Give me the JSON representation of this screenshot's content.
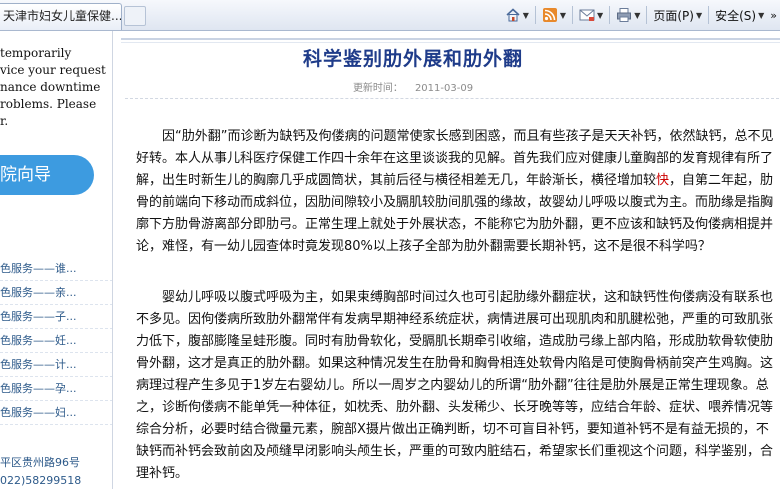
{
  "browser": {
    "tab_title": "天津市妇女儿童保健...",
    "toolbar": {
      "page_menu_label": "页面(P)",
      "safety_menu_label": "安全(S)"
    }
  },
  "sidebar": {
    "notice_lines": [
      "temporarily",
      "vice your request",
      "nance downtime",
      "roblems. Please",
      "r."
    ],
    "guide_label": "院向导",
    "services": [
      "色服务——谁...",
      "色服务——亲...",
      "色服务——子...",
      "色服务——妊...",
      "色服务——计...",
      "色服务——孕...",
      "色服务——妇..."
    ],
    "address": "平区贵州路96号",
    "phone": "022)58299518"
  },
  "article": {
    "title": "科学鉴别肋外展和肋外翻",
    "meta_label": "更新时间：",
    "meta_date": "2011-03-09",
    "p1_before": "因“肋外翻”而诊断为缺钙及佝偻病的问题常使家长感到困惑，而且有些孩子是天天补钙，依然缺钙，总不见好转。本人从事儿科医疗保健工作四十余年在这里谈谈我的见解。首先我们应对健康儿童胸部的发育规律有所了解，出生时新生儿的胸廓几乎成圆筒状，其前后径与横径相差无几，年龄渐长，横径增加较",
    "p1_highlight": "快",
    "p1_after": "，自第二年起，肋骨的前端向下移动而成斜位，因肋间隙较小及膈肌较肋间肌强的缘故，故婴幼儿呼吸以腹式为主。而肋缘是指胸廓下方肋骨游离部分即肋弓。正常生理上就处于外展状态，不能称它为肋外翻，更不应该和缺钙及佝偻病相提并论，难怪，有一幼儿园查体时竟发现80%以上孩子全部为肋外翻需要长期补钙，这不是很不科学吗？",
    "p2": "婴幼儿呼吸以腹式呼吸为主，如果束缚胸部时间过久也可引起肋缘外翻症状，这和缺钙性佝偻病没有联系也不多见。因佝偻病所致肋外翻常伴有发病早期神经系统症状，病情进展可出现肌肉和肌腱松弛，严重的可致肌张力低下，腹部膨隆呈蛙形腹。同时有肋骨软化，受膈肌长期牵引收缩，造成肋弓缘上部内陷，形成肋软骨软使肋骨外翻，这才是真正的肋外翻。如果这种情况发生在肋骨和胸骨相连处软骨内陷是可使胸骨柄前突产生鸡胸。这病理过程产生多见于1岁左右婴幼儿。所以一周岁之内婴幼儿的所谓“肋外翻”往往是肋外展是正常生理现象。总之，诊断佝偻病不能单凭一种体征，如枕秃、肋外翻、头发稀少、长牙晚等等，应结合年龄、症状、喂养情况等综合分析，必要时结合微量元素，腕部X摄片做出正确判断，切不可盲目补钙，要知道补钙不是有益无损的，不缺钙而补钙会致前囟及颅缝早闭影响头颅生长，严重的可致内脏结石，希望家长们重视这个问题，科学鉴别，合理补钙。"
  },
  "colors": {
    "title": "#1f3c8a",
    "sidebar_accent": "#3d9be0",
    "highlight": "#cc0000",
    "link": "#2d5a8a"
  },
  "icons": [
    "home-icon",
    "feeds-icon",
    "mail-icon",
    "print-icon",
    "page-menu",
    "safety-menu"
  ]
}
